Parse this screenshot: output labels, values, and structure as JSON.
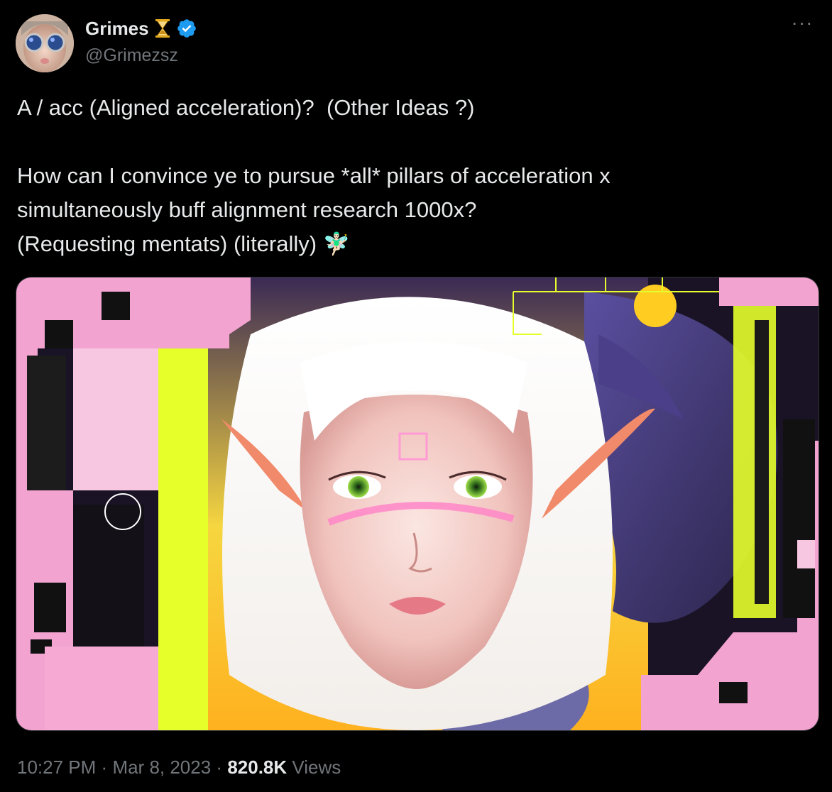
{
  "author": {
    "name": "Grimes",
    "handle": "@Grimezsz",
    "verified": true,
    "badge_emoji": "⏳"
  },
  "tweet": {
    "line1": "A / acc (Aligned acceleration)?  (Other Ideas ?)",
    "line2": "How can I convince ye to pursue *all* pillars of acceleration x",
    "line3": "simultaneously buff alignment research 1000x?",
    "line4": "(Requesting mentats) (literally)",
    "emoji": "🧚🏻‍♂️"
  },
  "meta": {
    "time": "10:27 PM",
    "sep1": "·",
    "date": "Mar 8, 2023",
    "sep2": "·",
    "views_count": "820.8K",
    "views_label": "Views"
  },
  "menu": {
    "more_label": "···"
  },
  "colors": {
    "background": "#000000",
    "text": "#e7e9ea",
    "muted": "#71767b",
    "verified": "#1d9bf0",
    "pink": "#f2a3cf",
    "neon": "#e6ff2a"
  },
  "media": {
    "alt": "Digital artwork of a white-haired elf girl with green eyes framed by pink and neon-yellow cyberpunk UI panels"
  }
}
